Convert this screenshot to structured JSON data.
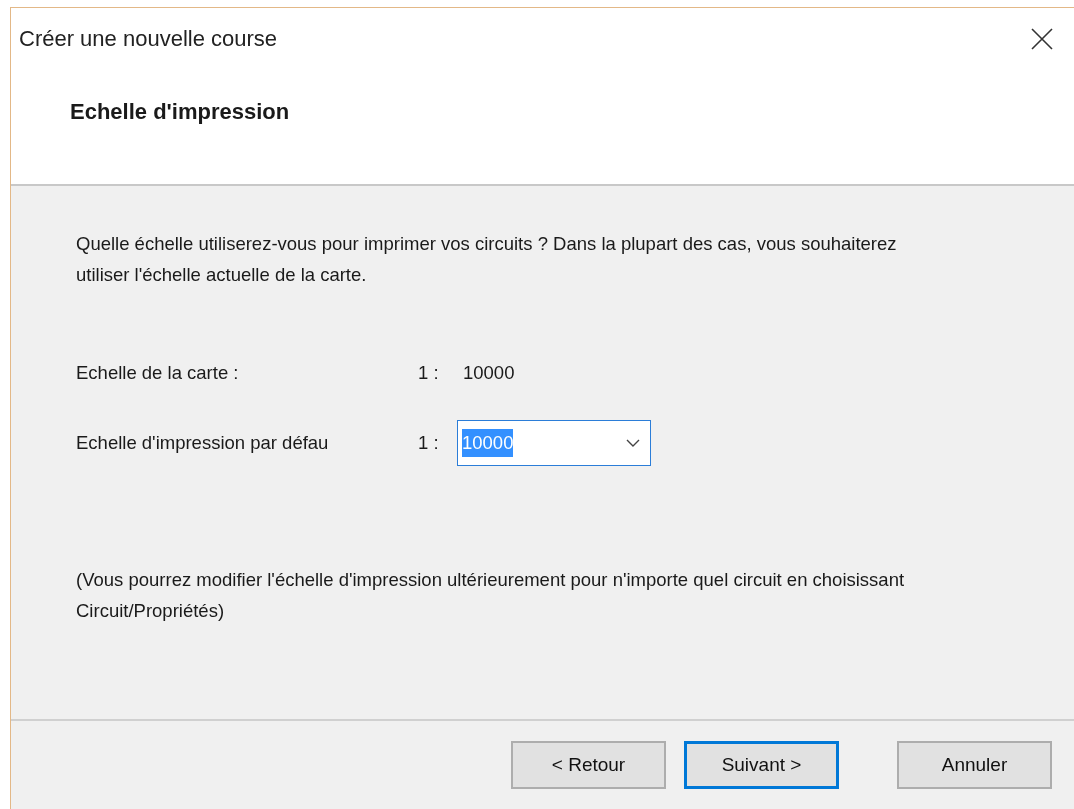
{
  "window": {
    "title": "Créer une nouvelle course"
  },
  "header": {
    "title": "Echelle d'impression"
  },
  "intro": "Quelle échelle utiliserez-vous pour imprimer vos circuits ? Dans la plupart des cas, vous souhaiterez utiliser l'échelle actuelle de la carte.",
  "fields": [
    {
      "kind": "text",
      "label": "Echelle de la carte :",
      "prefix": "1 :",
      "value": "10000"
    },
    {
      "kind": "combo",
      "label": "Echelle d'impression par défau",
      "prefix": "1 :",
      "value": "10000",
      "text_selected": true
    }
  ],
  "note": "(Vous pourrez modifier l'échelle d'impression ultérieurement pour n'importe quel circuit en choisissant Circuit/Propriétés)",
  "buttons": [
    {
      "label": "< Retour",
      "default": false
    },
    {
      "label": "Suivant >",
      "default": true
    },
    {
      "label": "Annuler",
      "default": false
    }
  ]
}
